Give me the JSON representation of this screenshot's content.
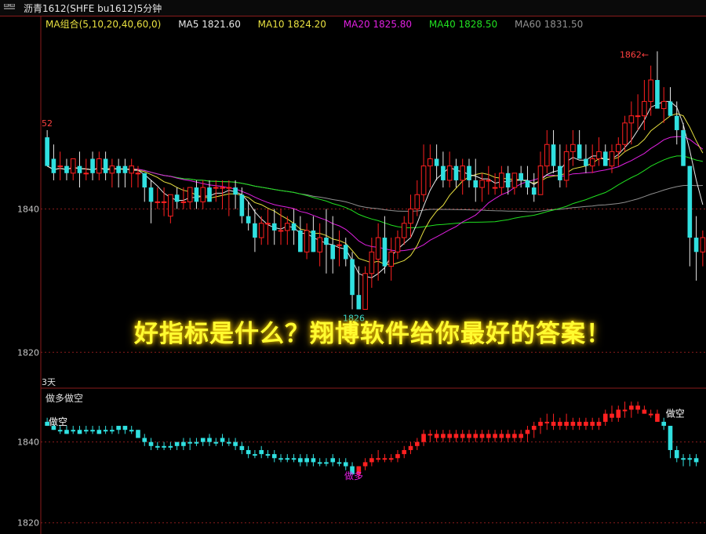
{
  "window": {
    "title": "沥青1612(SHFE bu1612)5分钟"
  },
  "legend": {
    "group": "MA组合(5,10,20,40,60,0)",
    "ma5": "MA5 1821.60",
    "ma10": "MA10 1824.20",
    "ma20": "MA20 1825.80",
    "ma40": "MA40 1828.50",
    "ma60": "MA60 1831.50"
  },
  "colors": {
    "up": "#ff2020",
    "down": "#30e0e0",
    "ma5": "#e8e8e8",
    "ma10": "#e8e040",
    "ma20": "#e020e0",
    "ma40": "#20e020",
    "ma60": "#909090",
    "grid": "#8a1c1c"
  },
  "annotations": {
    "high_label": "1862",
    "low_label": "1826",
    "left_clip_label": "52",
    "days_label": "3天",
    "sub_title": "做多做空",
    "sub_short_left": "做空",
    "sub_long": "做多",
    "sub_short_right": "做空"
  },
  "slogan": "好指标是什么？翔博软件给你最好的答案！",
  "chart_data": {
    "type": "candlestick",
    "title": "沥青1612(SHFE bu1612)5分钟",
    "timeframe": "5分钟",
    "main_yticks": [
      1840,
      1820
    ],
    "main_ylim": [
      1815,
      1865
    ],
    "sub_yticks": [
      1840,
      1820
    ],
    "sub_ylim": [
      1818,
      1851
    ],
    "grid": true,
    "high_marker": 1862,
    "low_marker": 1826,
    "main_candles": [
      [
        1850,
        1851,
        1846,
        1846
      ],
      [
        1847,
        1849,
        1844,
        1845
      ],
      [
        1846,
        1848,
        1844,
        1846
      ],
      [
        1846,
        1847,
        1844,
        1845
      ],
      [
        1845,
        1847,
        1844,
        1847
      ],
      [
        1846,
        1848,
        1843,
        1845
      ],
      [
        1845,
        1847,
        1844,
        1845
      ],
      [
        1847,
        1848,
        1844,
        1845
      ],
      [
        1845,
        1848,
        1844,
        1847
      ],
      [
        1847,
        1848,
        1844,
        1845
      ],
      [
        1845,
        1847,
        1843,
        1846
      ],
      [
        1846,
        1847,
        1843,
        1845
      ],
      [
        1846,
        1847,
        1843,
        1845
      ],
      [
        1845,
        1847,
        1843,
        1846
      ],
      [
        1845,
        1846,
        1843,
        1845
      ],
      [
        1845,
        1845,
        1841,
        1843
      ],
      [
        1843,
        1844,
        1838,
        1841
      ],
      [
        1841,
        1843,
        1840,
        1841
      ],
      [
        1841,
        1843,
        1839,
        1841
      ],
      [
        1839,
        1842,
        1838,
        1842
      ],
      [
        1842,
        1843,
        1840,
        1841
      ],
      [
        1841,
        1843,
        1840,
        1841
      ],
      [
        1841,
        1843,
        1840,
        1843
      ],
      [
        1843,
        1844,
        1840,
        1841
      ],
      [
        1841,
        1844,
        1840,
        1843
      ],
      [
        1843,
        1844,
        1841,
        1841
      ],
      [
        1843,
        1844,
        1841,
        1843
      ],
      [
        1843,
        1844,
        1840,
        1843
      ],
      [
        1843,
        1844,
        1839,
        1843
      ],
      [
        1843,
        1844,
        1840,
        1842
      ],
      [
        1842,
        1843,
        1838,
        1839
      ],
      [
        1839,
        1841,
        1837,
        1838
      ],
      [
        1838,
        1840,
        1834,
        1836
      ],
      [
        1836,
        1839,
        1835,
        1838
      ],
      [
        1838,
        1840,
        1835,
        1838
      ],
      [
        1838,
        1840,
        1835,
        1837
      ],
      [
        1837,
        1840,
        1835,
        1837
      ],
      [
        1837,
        1839,
        1835,
        1838
      ],
      [
        1838,
        1840,
        1835,
        1837
      ],
      [
        1837,
        1839,
        1834,
        1834
      ],
      [
        1834,
        1838,
        1833,
        1837
      ],
      [
        1837,
        1839,
        1834,
        1834
      ],
      [
        1834,
        1838,
        1832,
        1836
      ],
      [
        1836,
        1840,
        1831,
        1835
      ],
      [
        1835,
        1839,
        1831,
        1833
      ],
      [
        1835,
        1837,
        1832,
        1835
      ],
      [
        1835,
        1836,
        1832,
        1833
      ],
      [
        1833,
        1834,
        1826,
        1828
      ],
      [
        1828,
        1832,
        1826,
        1826
      ],
      [
        1826,
        1832,
        1826,
        1831
      ],
      [
        1831,
        1836,
        1829,
        1834
      ],
      [
        1833,
        1838,
        1830,
        1836
      ],
      [
        1836,
        1839,
        1831,
        1832
      ],
      [
        1832,
        1836,
        1830,
        1834
      ],
      [
        1834,
        1837,
        1833,
        1836
      ],
      [
        1836,
        1839,
        1835,
        1838
      ],
      [
        1838,
        1842,
        1836,
        1840
      ],
      [
        1840,
        1844,
        1839,
        1842
      ],
      [
        1842,
        1849,
        1841,
        1846
      ],
      [
        1846,
        1849,
        1843,
        1847
      ],
      [
        1847,
        1849,
        1844,
        1846
      ],
      [
        1846,
        1848,
        1843,
        1844
      ],
      [
        1844,
        1848,
        1843,
        1846
      ],
      [
        1846,
        1847,
        1843,
        1844
      ],
      [
        1844,
        1847,
        1842,
        1846
      ],
      [
        1846,
        1847,
        1843,
        1844
      ],
      [
        1844,
        1847,
        1841,
        1843
      ],
      [
        1843,
        1845,
        1841,
        1844
      ],
      [
        1844,
        1846,
        1842,
        1844
      ],
      [
        1843,
        1845,
        1842,
        1843
      ],
      [
        1843,
        1846,
        1842,
        1845
      ],
      [
        1845,
        1846,
        1842,
        1843
      ],
      [
        1843,
        1845,
        1842,
        1845
      ],
      [
        1845,
        1846,
        1843,
        1844
      ],
      [
        1844,
        1846,
        1842,
        1843
      ],
      [
        1843,
        1845,
        1841,
        1842
      ],
      [
        1842,
        1848,
        1842,
        1846
      ],
      [
        1846,
        1851,
        1845,
        1849
      ],
      [
        1849,
        1851,
        1845,
        1846
      ],
      [
        1846,
        1849,
        1843,
        1844
      ],
      [
        1844,
        1849,
        1843,
        1848
      ],
      [
        1848,
        1851,
        1846,
        1849
      ],
      [
        1849,
        1851,
        1847,
        1847
      ],
      [
        1847,
        1849,
        1845,
        1846
      ],
      [
        1846,
        1849,
        1845,
        1847
      ],
      [
        1847,
        1850,
        1846,
        1848
      ],
      [
        1848,
        1849,
        1846,
        1846
      ],
      [
        1846,
        1849,
        1845,
        1848
      ],
      [
        1848,
        1850,
        1846,
        1849
      ],
      [
        1849,
        1853,
        1848,
        1852
      ],
      [
        1852,
        1855,
        1849,
        1853
      ],
      [
        1853,
        1856,
        1851,
        1853
      ],
      [
        1853,
        1858,
        1851,
        1855
      ],
      [
        1855,
        1860,
        1853,
        1858
      ],
      [
        1858,
        1862,
        1855,
        1854
      ],
      [
        1854,
        1857,
        1852,
        1855
      ],
      [
        1855,
        1857,
        1853,
        1853
      ],
      [
        1853,
        1855,
        1849,
        1851
      ],
      [
        1851,
        1852,
        1846,
        1846
      ],
      [
        1846,
        1846,
        1832,
        1836
      ],
      [
        1836,
        1839,
        1830,
        1834
      ],
      [
        1834,
        1837,
        1832,
        1836
      ]
    ],
    "sub_bars": [
      [
        1845,
        1846,
        1844,
        1844
      ],
      [
        1844,
        1845,
        1843,
        1843
      ],
      [
        1843,
        1844,
        1842,
        1843
      ],
      [
        1843,
        1844,
        1842,
        1842
      ],
      [
        1843,
        1844,
        1842,
        1843
      ],
      [
        1843,
        1844,
        1842,
        1842
      ],
      [
        1843,
        1844,
        1842,
        1843
      ],
      [
        1843,
        1844,
        1842,
        1843
      ],
      [
        1843,
        1844,
        1842,
        1842
      ],
      [
        1843,
        1844,
        1842,
        1843
      ],
      [
        1843,
        1844,
        1842,
        1843
      ],
      [
        1843,
        1844,
        1842,
        1844
      ],
      [
        1844,
        1844,
        1842,
        1843
      ],
      [
        1843,
        1844,
        1842,
        1843
      ],
      [
        1843,
        1843,
        1841,
        1841
      ],
      [
        1841,
        1842,
        1839,
        1840
      ],
      [
        1840,
        1841,
        1838,
        1839
      ],
      [
        1839,
        1840,
        1838,
        1839
      ],
      [
        1839,
        1840,
        1838,
        1839
      ],
      [
        1839,
        1840,
        1838,
        1839
      ],
      [
        1839,
        1840,
        1838,
        1840
      ],
      [
        1840,
        1841,
        1838,
        1839
      ],
      [
        1840,
        1841,
        1838,
        1840
      ],
      [
        1840,
        1841,
        1839,
        1840
      ],
      [
        1840,
        1841,
        1839,
        1841
      ],
      [
        1841,
        1842,
        1839,
        1840
      ],
      [
        1840,
        1841,
        1839,
        1840
      ],
      [
        1841,
        1842,
        1839,
        1840
      ],
      [
        1840,
        1841,
        1839,
        1840
      ],
      [
        1840,
        1841,
        1838,
        1839
      ],
      [
        1839,
        1840,
        1837,
        1838
      ],
      [
        1838,
        1839,
        1836,
        1837
      ],
      [
        1837,
        1838,
        1836,
        1837
      ],
      [
        1838,
        1839,
        1836,
        1837
      ],
      [
        1837,
        1838,
        1836,
        1837
      ],
      [
        1837,
        1838,
        1835,
        1836
      ],
      [
        1836,
        1837,
        1835,
        1836
      ],
      [
        1836,
        1837,
        1835,
        1836
      ],
      [
        1836,
        1837,
        1835,
        1836
      ],
      [
        1836,
        1837,
        1834,
        1835
      ],
      [
        1835,
        1837,
        1834,
        1836
      ],
      [
        1836,
        1837,
        1834,
        1835
      ],
      [
        1835,
        1836,
        1834,
        1835
      ],
      [
        1835,
        1836,
        1834,
        1835
      ],
      [
        1836,
        1837,
        1834,
        1835
      ],
      [
        1835,
        1836,
        1834,
        1835
      ],
      [
        1835,
        1836,
        1833,
        1834
      ],
      [
        1834,
        1835,
        1832,
        1832
      ],
      [
        1832,
        1834,
        1831,
        1834
      ],
      [
        1834,
        1836,
        1833,
        1835
      ],
      [
        1835,
        1837,
        1834,
        1836
      ],
      [
        1836,
        1838,
        1835,
        1836
      ],
      [
        1836,
        1837,
        1835,
        1836
      ],
      [
        1836,
        1837,
        1835,
        1836
      ],
      [
        1836,
        1838,
        1835,
        1837
      ],
      [
        1837,
        1839,
        1836,
        1838
      ],
      [
        1838,
        1840,
        1837,
        1839
      ],
      [
        1839,
        1841,
        1838,
        1840
      ],
      [
        1840,
        1843,
        1839,
        1842
      ],
      [
        1842,
        1843,
        1840,
        1842
      ],
      [
        1842,
        1843,
        1840,
        1841
      ],
      [
        1841,
        1843,
        1840,
        1842
      ],
      [
        1842,
        1843,
        1840,
        1841
      ],
      [
        1841,
        1843,
        1840,
        1842
      ],
      [
        1842,
        1843,
        1840,
        1841
      ],
      [
        1841,
        1843,
        1840,
        1842
      ],
      [
        1842,
        1843,
        1840,
        1841
      ],
      [
        1841,
        1843,
        1840,
        1842
      ],
      [
        1842,
        1843,
        1840,
        1841
      ],
      [
        1841,
        1843,
        1840,
        1842
      ],
      [
        1842,
        1843,
        1840,
        1841
      ],
      [
        1841,
        1843,
        1840,
        1842
      ],
      [
        1842,
        1843,
        1840,
        1841
      ],
      [
        1841,
        1843,
        1840,
        1842
      ],
      [
        1842,
        1844,
        1840,
        1843
      ],
      [
        1843,
        1845,
        1841,
        1844
      ],
      [
        1844,
        1846,
        1842,
        1845
      ],
      [
        1845,
        1847,
        1843,
        1845
      ],
      [
        1845,
        1847,
        1843,
        1844
      ],
      [
        1844,
        1846,
        1843,
        1845
      ],
      [
        1845,
        1847,
        1843,
        1844
      ],
      [
        1844,
        1846,
        1843,
        1845
      ],
      [
        1845,
        1846,
        1843,
        1844
      ],
      [
        1844,
        1846,
        1843,
        1845
      ],
      [
        1845,
        1846,
        1843,
        1844
      ],
      [
        1844,
        1846,
        1843,
        1845
      ],
      [
        1845,
        1848,
        1844,
        1847
      ],
      [
        1847,
        1849,
        1845,
        1846
      ],
      [
        1846,
        1849,
        1845,
        1848
      ],
      [
        1848,
        1850,
        1846,
        1848
      ],
      [
        1848,
        1850,
        1846,
        1849
      ],
      [
        1849,
        1850,
        1847,
        1848
      ],
      [
        1848,
        1849,
        1847,
        1847
      ],
      [
        1847,
        1848,
        1846,
        1847
      ],
      [
        1847,
        1848,
        1845,
        1845
      ],
      [
        1845,
        1846,
        1843,
        1844
      ],
      [
        1844,
        1844,
        1836,
        1838
      ],
      [
        1838,
        1839,
        1835,
        1836
      ],
      [
        1836,
        1837,
        1834,
        1836
      ],
      [
        1836,
        1837,
        1834,
        1836
      ],
      [
        1836,
        1837,
        1834,
        1835
      ]
    ]
  }
}
